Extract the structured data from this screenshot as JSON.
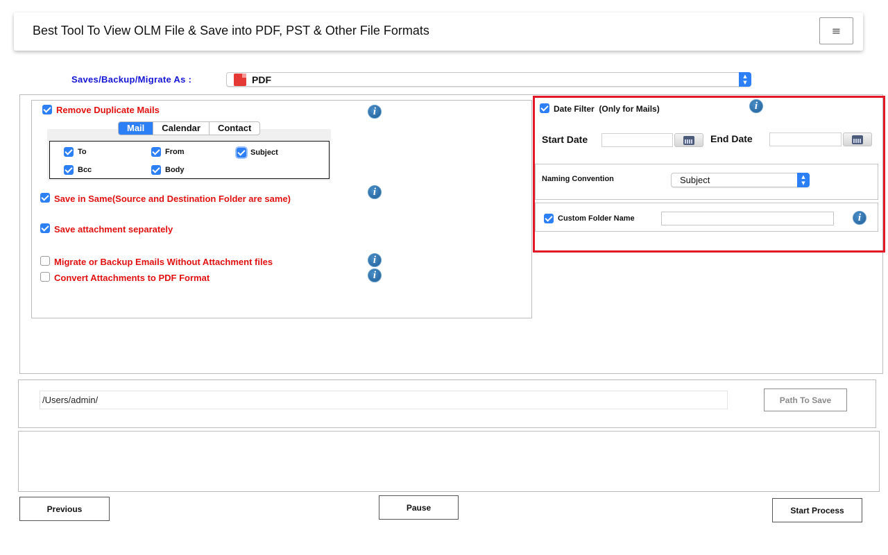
{
  "header": {
    "title": "Best Tool To View OLM File & Save into PDF, PST & Other File Formats",
    "menu_icon": "≡"
  },
  "saves": {
    "label": "Saves/Backup/Migrate As :",
    "selected_format": "PDF",
    "format_icon": "pdf-icon"
  },
  "options": {
    "remove_duplicates": {
      "label": "Remove Duplicate Mails",
      "checked": true
    },
    "tabs": [
      {
        "label": "Mail",
        "active": true
      },
      {
        "label": "Calendar",
        "active": false
      },
      {
        "label": "Contact",
        "active": false
      }
    ],
    "fields": [
      {
        "label": "To",
        "checked": true
      },
      {
        "label": "From",
        "checked": true
      },
      {
        "label": "Subject",
        "checked": true
      },
      {
        "label": "Bcc",
        "checked": true
      },
      {
        "label": "Body",
        "checked": true
      }
    ],
    "save_in_same": {
      "label": "Save in Same(Source and Destination Folder are same)",
      "checked": true
    },
    "save_attachment": {
      "label": "Save attachment separately",
      "checked": true
    },
    "without_attachment": {
      "label": "Migrate or Backup Emails Without Attachment files",
      "checked": false
    },
    "convert_attachments": {
      "label": "Convert Attachments to PDF Format",
      "checked": false
    }
  },
  "date_filter": {
    "label": "Date Filter",
    "note": "(Only for Mails)",
    "checked": true,
    "start_label": "Start Date",
    "end_label": "End Date",
    "start_value": "",
    "end_value": ""
  },
  "naming": {
    "label": "Naming Convention",
    "selected": "Subject"
  },
  "custom_folder": {
    "label": "Custom Folder Name",
    "checked": true,
    "value": ""
  },
  "path": {
    "value": "/Users/admin/",
    "button": "Path To Save"
  },
  "buttons": {
    "previous": "Previous",
    "pause": "Pause",
    "start": "Start Process"
  },
  "colors": {
    "accent_blue": "#2d7ff5",
    "label_red": "#e01010",
    "label_blue": "#1515d6",
    "highlight_border": "#e01828"
  }
}
